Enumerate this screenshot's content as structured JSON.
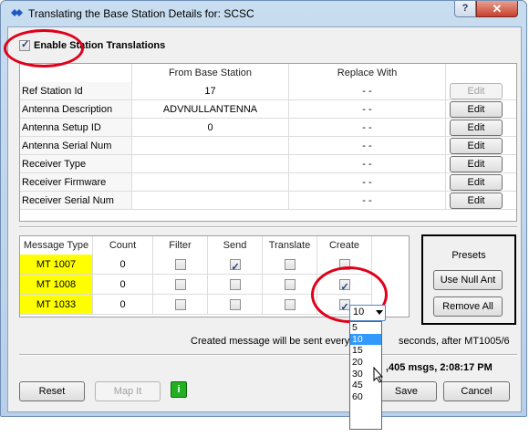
{
  "window": {
    "title": "Translating the Base Station Details for: SCSC",
    "help_label": "?",
    "close_label": "✕"
  },
  "enable_translations": {
    "label": "Enable Station Translations",
    "checked": true
  },
  "details_table": {
    "columns": [
      "From Base Station",
      "Replace With"
    ],
    "rows": [
      {
        "label": "Ref Station Id",
        "from": "17",
        "replace": "- -",
        "edit": "Edit",
        "edit_enabled": false
      },
      {
        "label": "Antenna Description",
        "from": "ADVNULLANTENNA",
        "replace": "- -",
        "edit": "Edit",
        "edit_enabled": true
      },
      {
        "label": "Antenna Setup ID",
        "from": "0",
        "replace": "- -",
        "edit": "Edit",
        "edit_enabled": true
      },
      {
        "label": "Antenna Serial Num",
        "from": "",
        "replace": "- -",
        "edit": "Edit",
        "edit_enabled": true
      },
      {
        "label": "Receiver Type",
        "from": "",
        "replace": "- -",
        "edit": "Edit",
        "edit_enabled": true
      },
      {
        "label": "Receiver Firmware",
        "from": "",
        "replace": "- -",
        "edit": "Edit",
        "edit_enabled": true
      },
      {
        "label": "Receiver Serial Num",
        "from": "",
        "replace": "- -",
        "edit": "Edit",
        "edit_enabled": true
      }
    ]
  },
  "message_table": {
    "columns": [
      "Message Type",
      "Count",
      "Filter",
      "Send",
      "Translate",
      "Create"
    ],
    "rows": [
      {
        "type": "MT 1007",
        "count": "0",
        "filter": false,
        "send": true,
        "translate": false,
        "create": false
      },
      {
        "type": "MT 1008",
        "count": "0",
        "filter": false,
        "send": false,
        "translate": false,
        "create": true
      },
      {
        "type": "MT 1033",
        "count": "0",
        "filter": false,
        "send": false,
        "translate": false,
        "create": true
      }
    ]
  },
  "presets": {
    "title": "Presets",
    "use_null_ant": "Use Null Ant",
    "remove_all": "Remove All"
  },
  "interval": {
    "prefix": "Created message will be sent every:",
    "value": "10",
    "suffix": "seconds, after MT1005/6",
    "options": [
      "5",
      "10",
      "15",
      "20",
      "30",
      "45",
      "60"
    ],
    "highlighted": "10"
  },
  "status": {
    "text": ",405 msgs,   2:08:17 PM"
  },
  "footer": {
    "reset": "Reset",
    "map_it": "Map It",
    "info": "i",
    "save": "Save",
    "cancel": "Cancel"
  },
  "colors": {
    "highlight": "#ffff00",
    "annotation": "#e0001a",
    "info_green": "#22b022"
  }
}
